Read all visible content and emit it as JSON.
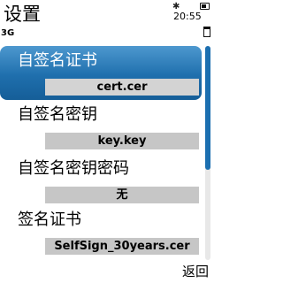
{
  "status": {
    "title": "设置",
    "time": "20:55",
    "network": "3G",
    "icons": [
      "bluetooth-icon",
      "battery-icon",
      "signal-icon"
    ]
  },
  "settings": [
    {
      "label": "自签名证书",
      "value": "cert.cer",
      "selected": true
    },
    {
      "label": "自签名密钥",
      "value": "key.key",
      "selected": false
    },
    {
      "label": "自签名密钥密码",
      "value": "无",
      "selected": false
    },
    {
      "label": "签名证书",
      "value": "SelfSign_30years.cer",
      "selected": false
    }
  ],
  "softkeys": {
    "right": "返回"
  },
  "colors": {
    "highlight": "#1f6fad",
    "value_box": "#c6c6c6",
    "scroll_thumb": "#1c6fb0"
  }
}
